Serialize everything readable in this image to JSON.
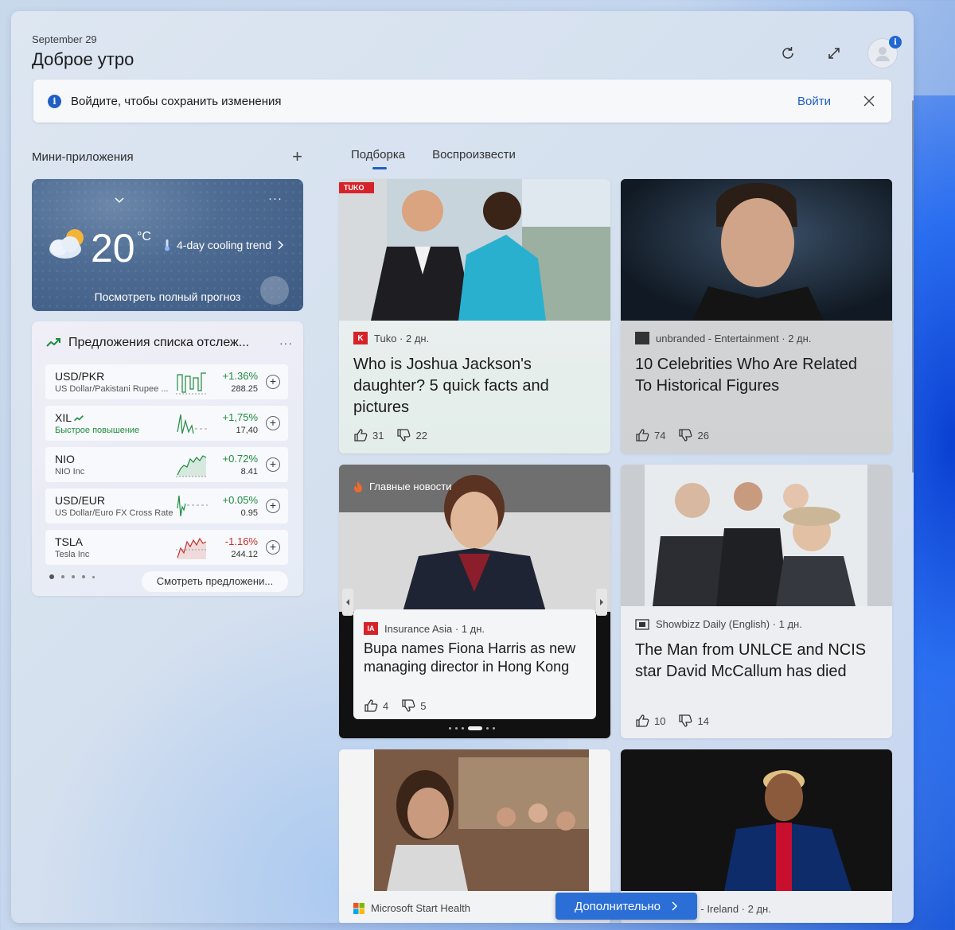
{
  "header": {
    "date": "September 29",
    "greeting": "Доброе утро",
    "notification_badge": "i"
  },
  "signin_bar": {
    "info_icon": "i",
    "message": "Войдите, чтобы сохранить изменения",
    "action": "Войти"
  },
  "widgets": {
    "title": "Мини-приложения",
    "add": "+"
  },
  "weather": {
    "temperature": "20",
    "unit": "°C",
    "trend": "4-day cooling trend",
    "full_forecast": "Посмотреть полный прогноз",
    "more": "···",
    "icon": "partly-cloudy-icon"
  },
  "watchlist": {
    "title": "Предложения списка отслеж...",
    "more": "···",
    "see_more": "Смотреть предложени...",
    "stocks": [
      {
        "symbol": "USD/PKR",
        "name": "US Dollar/Pakistani Rupee ...",
        "change": "+1.36%",
        "price": "288.25",
        "trend": "up"
      },
      {
        "symbol": "XIL",
        "name": "Быстрое повышение",
        "change": "+1,75%",
        "price": "17,40",
        "trend": "up"
      },
      {
        "symbol": "NIO",
        "name": "NIO Inc",
        "change": "+0.72%",
        "price": "8.41",
        "trend": "up"
      },
      {
        "symbol": "USD/EUR",
        "name": "US Dollar/Euro FX Cross Rate",
        "change": "+0.05%",
        "price": "0.95",
        "trend": "up"
      },
      {
        "symbol": "TSLA",
        "name": "Tesla Inc",
        "change": "-1.16%",
        "price": "244.12",
        "trend": "down"
      }
    ]
  },
  "feed": {
    "tabs": [
      "Подборка",
      "Воспроизвести"
    ],
    "cards": [
      {
        "source": "Tuko · 2 дн.",
        "logo": "K",
        "image_tag": "TUKO",
        "headline": "Who is Joshua Jackson's daughter? 5 quick facts and pictures",
        "likes": "31",
        "dislikes": "22"
      },
      {
        "source": "unbranded - Entertainment · 2 дн.",
        "headline": "10 Celebrities Who Are Related To Historical Figures",
        "likes": "74",
        "dislikes": "26"
      },
      {
        "source": "Insurance Asia · 1 дн.",
        "logo": "IA",
        "section": "Главные новости",
        "headline": "Bupa names Fiona Harris as new managing director in Hong Kong",
        "likes": "4",
        "dislikes": "5"
      },
      {
        "source": "Showbizz Daily (English) · 1 дн.",
        "headline": "The Man from UNLCE and NCIS star David McCallum has died",
        "likes": "10",
        "dislikes": "14"
      },
      {
        "source": "Microsoft Start Health"
      },
      {
        "source": "Sport247 - Ireland · 2 дн."
      }
    ],
    "more_button": "Дополнительно"
  },
  "colors": {
    "accent": "#1f5fc4",
    "positive": "#1d8c3e",
    "negative": "#c4312b"
  }
}
